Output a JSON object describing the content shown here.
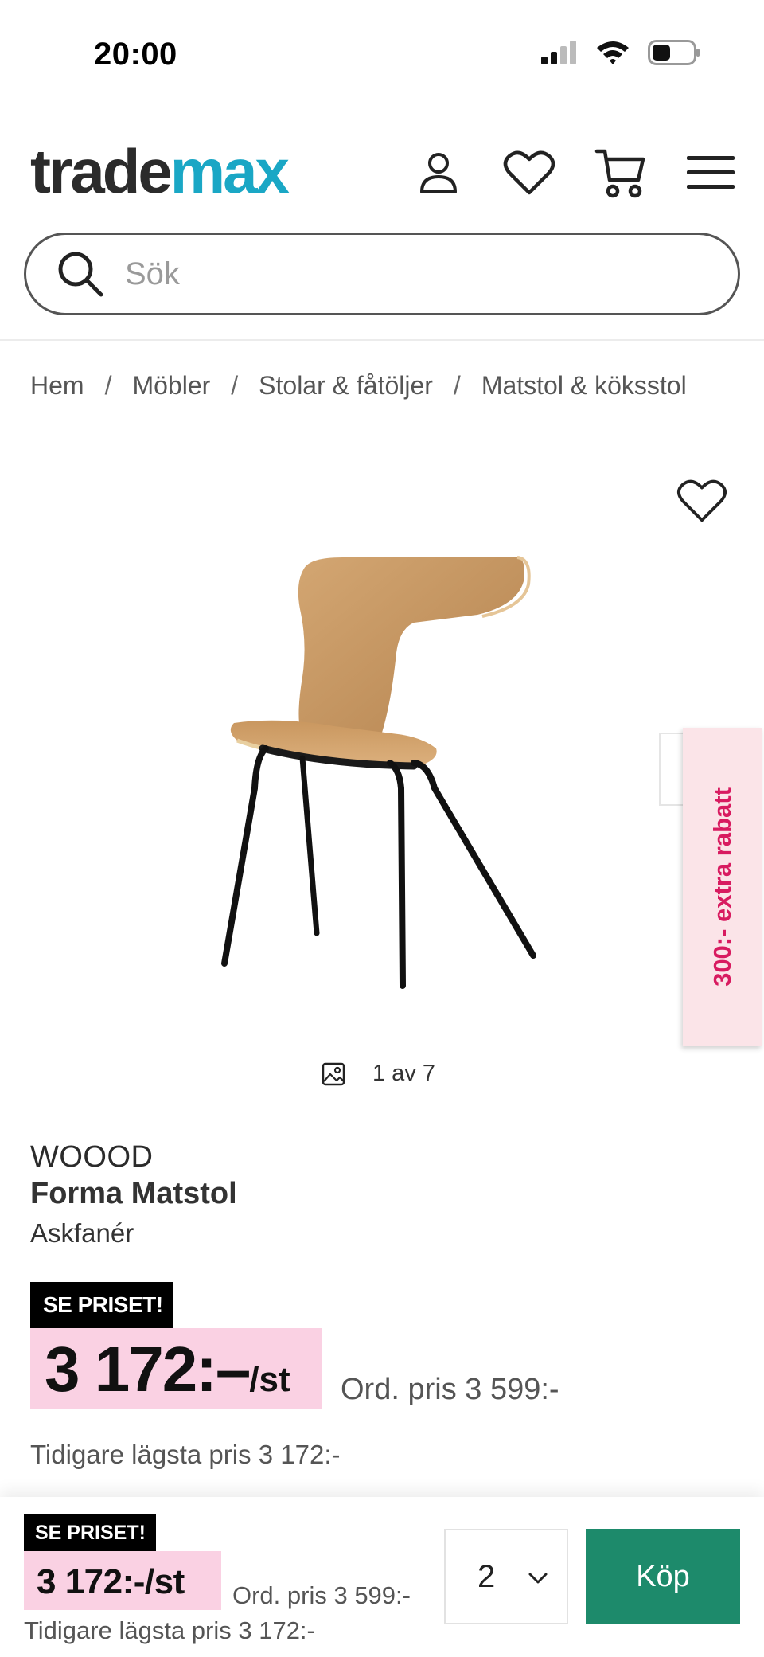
{
  "status_bar": {
    "time": "20:00",
    "icons": [
      "signal-icon",
      "wifi-icon",
      "battery-icon"
    ]
  },
  "header": {
    "logo_part1": "trade",
    "logo_part2": "max",
    "icons": [
      "account-icon",
      "wishlist-icon",
      "cart-icon",
      "menu-icon"
    ]
  },
  "search": {
    "placeholder": "Sök"
  },
  "breadcrumb": {
    "items": [
      "Hem",
      "Möbler",
      "Stolar & fåtöljer",
      "Matstol & köksstol"
    ],
    "separator": "/"
  },
  "gallery": {
    "counter": "1 av 7",
    "promo_tab": "300:- extra rabatt"
  },
  "product": {
    "brand": "WOOOD",
    "name": "Forma Matstol",
    "variant": "Askfanér",
    "badge": "SE PRISET!",
    "price": "3 172:–",
    "unit": "/st",
    "ordinary_price": "Ord. pris 3 599:-",
    "lowest_price": "Tidigare lägsta pris 3 172:-"
  },
  "buy_bar": {
    "badge": "SE PRISET!",
    "price": "3 172:-/st",
    "ordinary_price": "Ord. pris 3 599:-",
    "lowest_price": "Tidigare lägsta pris 3 172:-",
    "quantity": "2",
    "buy_label": "Köp"
  },
  "colors": {
    "accent": "#1aa7c5",
    "price_highlight": "#fad1e3",
    "promo": "#d81b60",
    "buy_button": "#1d8a6b"
  }
}
